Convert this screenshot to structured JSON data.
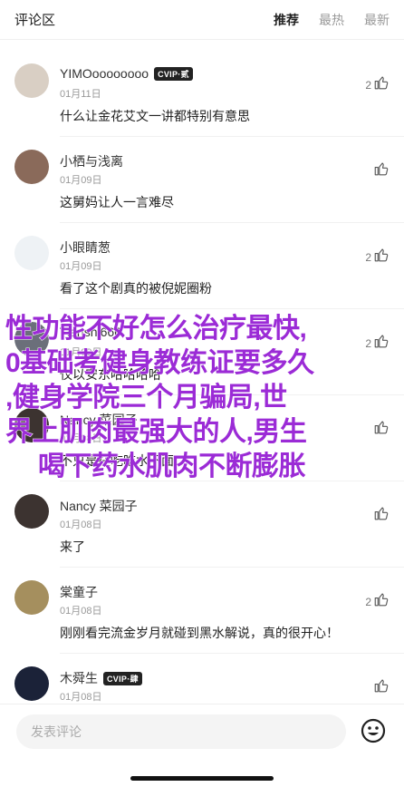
{
  "header": {
    "title": "评论区",
    "tabs": [
      "推荐",
      "最热",
      "最新"
    ],
    "active_tab": "推荐"
  },
  "comments": [
    {
      "name": "YIMOoooooooo",
      "badge": "CVIP·贰",
      "date": "01月11日",
      "text": "什么让金花艾文一讲都特别有意思",
      "likes": "2",
      "avatar_color": "#d9cfc4"
    },
    {
      "name": "小栖与浅离",
      "badge": "",
      "date": "01月09日",
      "text": "这舅妈让人一言难尽",
      "likes": "",
      "avatar_color": "#8a6a5a"
    },
    {
      "name": "小眼睛葱",
      "badge": "",
      "date": "01月09日",
      "text": "看了这个剧真的被倪妮圈粉",
      "likes": "2",
      "avatar_color": "#eef2f5"
    },
    {
      "name": "Tianshi666",
      "badge": "",
      "date": "01月09日",
      "text": "仅以安东哈哈哈哈",
      "likes": "2",
      "avatar_color": "#6b6f7a"
    },
    {
      "name": "Nancy 菜园子",
      "badge": "",
      "date": "01月08日",
      "text": "不只是在吃吃水下面",
      "likes": "",
      "avatar_color": "#3c3330"
    },
    {
      "name": "Nancy 菜园子",
      "badge": "",
      "date": "01月08日",
      "text": "来了",
      "likes": "",
      "avatar_color": "#3c3330"
    },
    {
      "name": "棠童子",
      "badge": "",
      "date": "01月08日",
      "text": "刚刚看完流金岁月就碰到黑水解说，真的很开心！",
      "likes": "2",
      "avatar_color": "#a58f5e"
    },
    {
      "name": "木舜生",
      "badge": "CVIP·肆",
      "date": "01月08日",
      "text": "",
      "likes": "",
      "avatar_color": "#1b2238"
    }
  ],
  "overlay_text": [
    "性功能不好怎么治疗最快,",
    "0基础考健身教练证要多久",
    ",健身学院三个月骗局,世",
    "界上肌肉最强大的人,男生",
    "喝下药水肌肉不断膨胀"
  ],
  "footer": {
    "input_placeholder": "发表评论"
  },
  "colors": {
    "overlay": "#9b2bd6",
    "badge_bg": "#222222"
  }
}
